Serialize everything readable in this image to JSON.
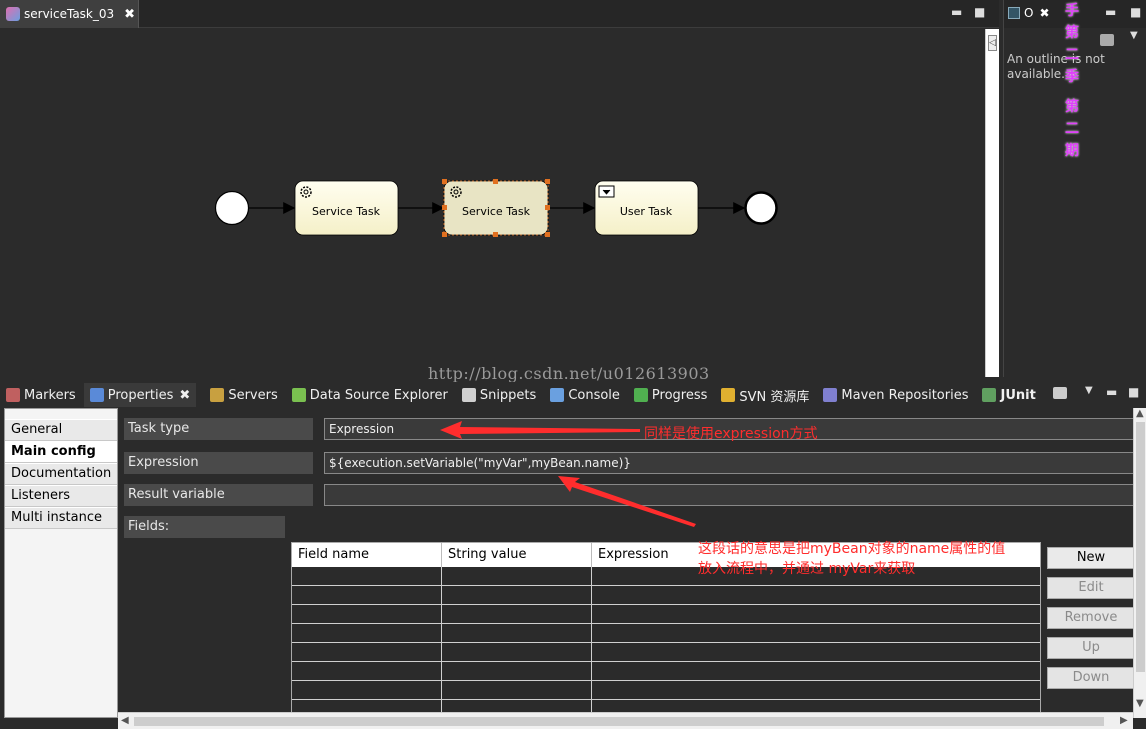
{
  "editor": {
    "tab_label": "serviceTask_03",
    "close_glyph": "✖",
    "minimize_glyph": "▬",
    "maximize_glyph": "■"
  },
  "diagram": {
    "task1_label": "Service Task",
    "task2_label": "Service Task",
    "task3_label": "User Task"
  },
  "outline": {
    "tab_label": "O",
    "message": "An outline is not available.",
    "deco_text": [
      "手",
      "第",
      "二",
      "季",
      "第",
      "二",
      "期"
    ]
  },
  "views": {
    "tabs": [
      {
        "label": "Markers",
        "icon": "markers-icon",
        "color": "#c06060"
      },
      {
        "label": "Properties",
        "icon": "properties-icon",
        "color": "#5a8ad8"
      },
      {
        "label": "Servers",
        "icon": "servers-icon",
        "color": "#c8a040"
      },
      {
        "label": "Data Source Explorer",
        "icon": "data-source-icon",
        "color": "#7ac050"
      },
      {
        "label": "Snippets",
        "icon": "snippets-icon",
        "color": "#d0d0d0"
      },
      {
        "label": "Console",
        "icon": "console-icon",
        "color": "#6aa0e0"
      },
      {
        "label": "Progress",
        "icon": "progress-icon",
        "color": "#50b050"
      },
      {
        "label": "SVN 资源库",
        "icon": "svn-icon",
        "color": "#e0b030"
      },
      {
        "label": "Maven Repositories",
        "icon": "maven-icon",
        "color": "#8080d0"
      },
      {
        "label": "JUnit",
        "icon": "junit-icon",
        "color": "#60a060"
      }
    ]
  },
  "properties": {
    "side_tabs": [
      "General",
      "Main config",
      "Documentation",
      "Listeners",
      "Multi instance"
    ],
    "task_type_label": "Task type",
    "task_type_value": "Expression",
    "expression_label": "Expression",
    "expression_value": "${execution.setVariable(\"myVar\",myBean.name)}",
    "result_variable_label": "Result variable",
    "result_variable_value": "",
    "fields_label": "Fields:",
    "table_headers": [
      "Field name",
      "String value",
      "Expression"
    ],
    "buttons": [
      "New",
      "Edit",
      "Remove",
      "Up",
      "Down"
    ]
  },
  "annotations": {
    "note1": "同样是使用expression方式",
    "note2_line1": "这段话的意思是把myBean对象的name属性的值",
    "note2_line2": "放入流程中，并通过 myVar来获取"
  },
  "watermark": "http://blog.csdn.net/u012613903"
}
